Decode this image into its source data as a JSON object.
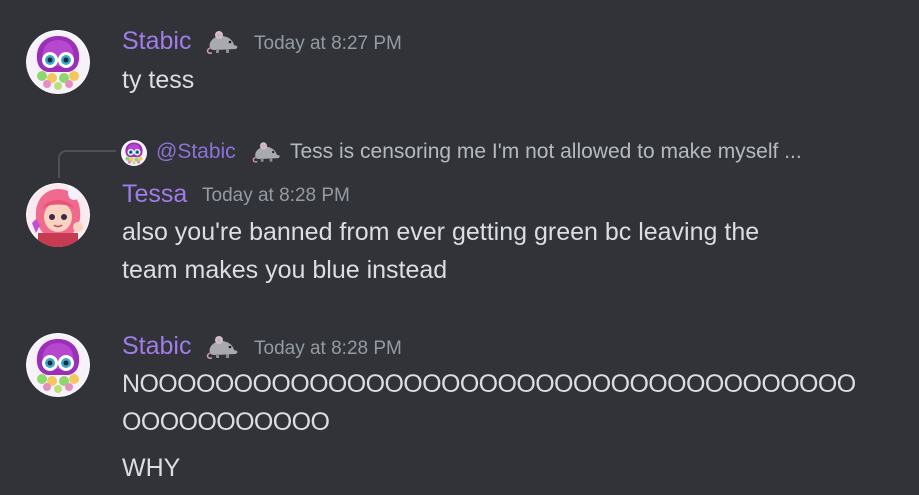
{
  "messages": [
    {
      "author": "Stabic",
      "badge": "rat-icon",
      "timestamp": "Today at 8:27 PM",
      "lines": [
        "ty tess"
      ]
    },
    {
      "reply": {
        "mention": "@Stabic",
        "badge": "rat-icon",
        "text": "Tess is censoring me I'm not allowed to make myself ..."
      },
      "author": "Tessa",
      "timestamp": "Today at 8:28 PM",
      "lines": [
        "also you're banned from ever getting green bc leaving the",
        "team makes you blue instead"
      ]
    },
    {
      "author": "Stabic",
      "badge": "rat-icon",
      "timestamp": "Today at 8:28 PM",
      "lines": [
        "NOOOOOOOOOOOOOOOOOOOOOOOOOOOOOOOOOOOOOO",
        "OOOOOOOOOOO",
        "WHY"
      ]
    }
  ],
  "colors": {
    "background": "#313338",
    "username": "#a07ce8",
    "timestamp": "#949ba4",
    "message": "#dbdee1",
    "reply_text": "#b5bac1"
  }
}
